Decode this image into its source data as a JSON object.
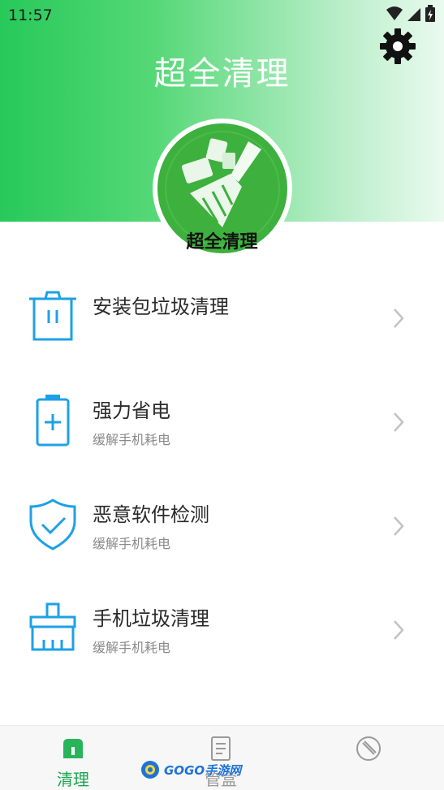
{
  "status_bar": {
    "time": "11:57"
  },
  "header": {
    "title": "超全清理",
    "logo_caption": "超全清理"
  },
  "colors": {
    "brand_green": "#27c95a",
    "icon_blue": "#1da1e6",
    "logo_green": "#3db03d"
  },
  "menu": [
    {
      "title": "安装包垃圾清理",
      "subtitle": "",
      "icon": "trash-icon"
    },
    {
      "title": "强力省电",
      "subtitle": "缓解手机耗电",
      "icon": "battery-icon"
    },
    {
      "title": "恶意软件检测",
      "subtitle": "缓解手机耗电",
      "icon": "shield-check-icon"
    },
    {
      "title": "手机垃圾清理",
      "subtitle": "缓解手机耗电",
      "icon": "broom-icon"
    }
  ],
  "bottom_nav": [
    {
      "label": "清理",
      "icon": "home-icon",
      "active": true
    },
    {
      "label": "管盒",
      "icon": "document-icon",
      "active": false
    },
    {
      "label": "",
      "icon": "compass-icon",
      "active": false
    }
  ],
  "watermark": {
    "text": "GOGO手游网"
  }
}
